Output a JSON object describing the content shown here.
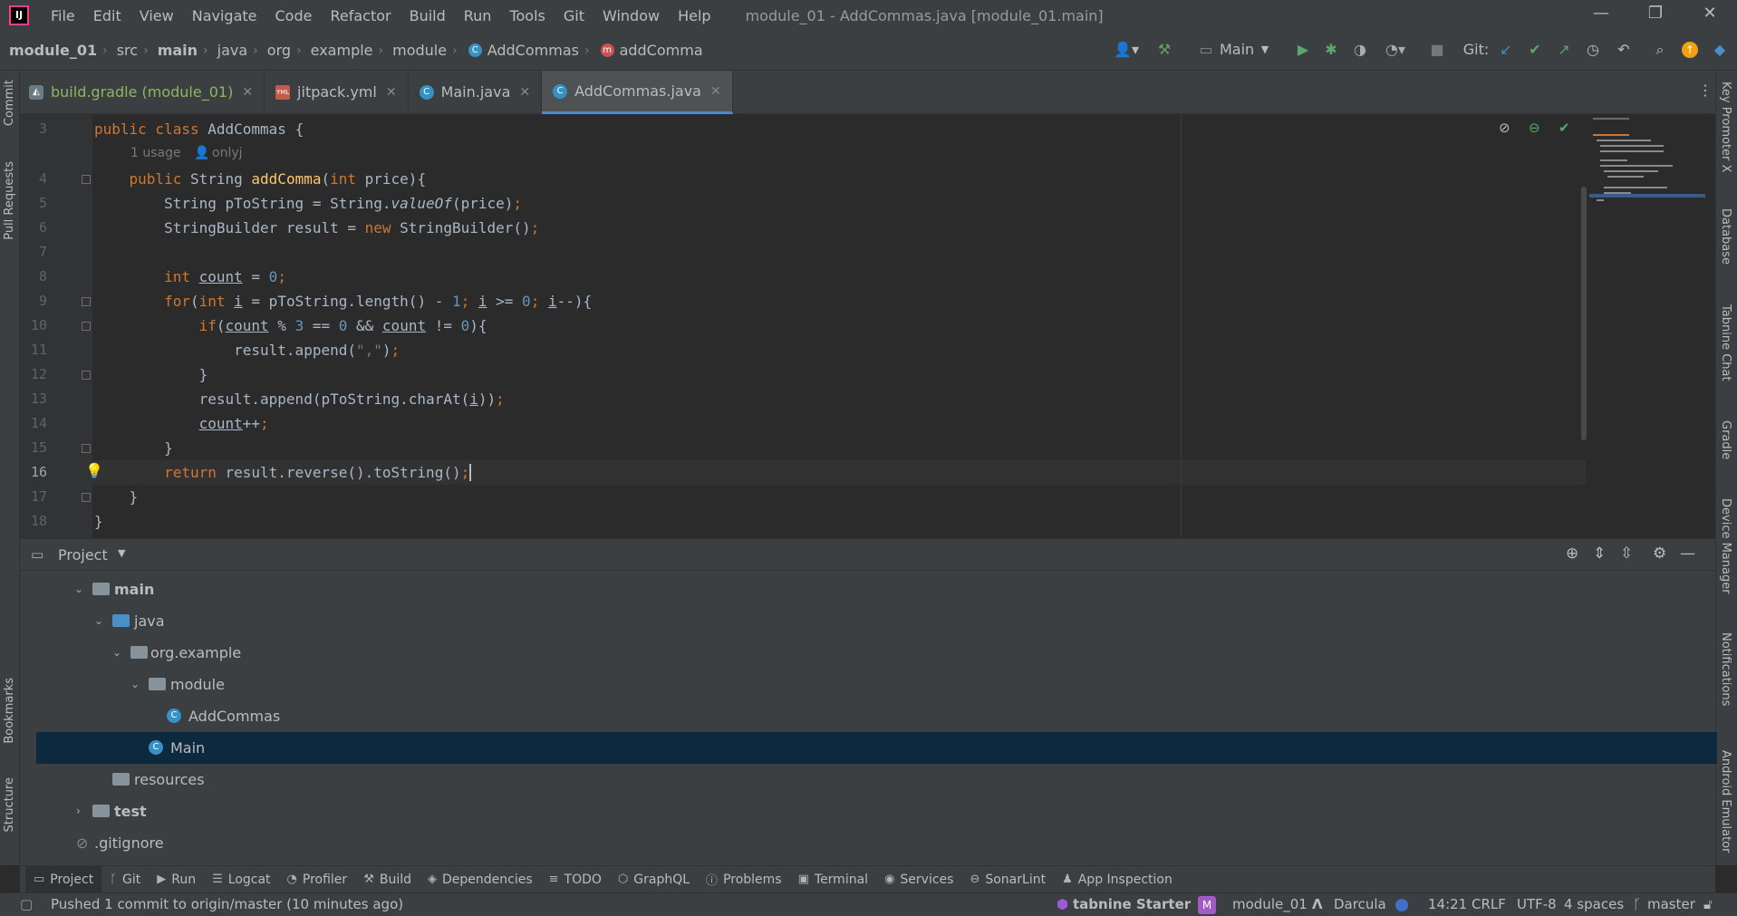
{
  "menubar": {
    "items": [
      "File",
      "Edit",
      "View",
      "Navigate",
      "Code",
      "Refactor",
      "Build",
      "Run",
      "Tools",
      "Git",
      "Window",
      "Help"
    ],
    "title": "module_01 - AddCommas.java [module_01.main]"
  },
  "breadcrumb": [
    "module_01",
    "src",
    "main",
    "java",
    "org",
    "example",
    "module",
    "AddCommas",
    "addComma"
  ],
  "toolbar": {
    "run_config": "Main",
    "git_label": "Git:"
  },
  "tabs": [
    {
      "label": "build.gradle (module_01)",
      "icon": "gradle-icon"
    },
    {
      "label": "jitpack.yml",
      "icon": "yaml-icon"
    },
    {
      "label": "Main.java",
      "icon": "java-class-icon"
    },
    {
      "label": "AddCommas.java",
      "icon": "java-class-icon",
      "active": true
    }
  ],
  "editor": {
    "caret_line": 16,
    "usage_hint": {
      "usages": "1 usage",
      "author": "onlyj"
    },
    "lines": [
      {
        "n": "3",
        "text": "public class AddCommas {"
      },
      {
        "n": "4",
        "text": "    public String addComma(int price){"
      },
      {
        "n": "5",
        "text": "        String pToString = String.valueOf(price);"
      },
      {
        "n": "6",
        "text": "        StringBuilder result = new StringBuilder();"
      },
      {
        "n": "7",
        "text": ""
      },
      {
        "n": "8",
        "text": "        int count = 0;"
      },
      {
        "n": "9",
        "text": "        for(int i = pToString.length() - 1; i >= 0; i--){"
      },
      {
        "n": "10",
        "text": "            if(count % 3 == 0 && count != 0){"
      },
      {
        "n": "11",
        "text": "                result.append(\",\");"
      },
      {
        "n": "12",
        "text": "            }"
      },
      {
        "n": "13",
        "text": "            result.append(pToString.charAt(i));"
      },
      {
        "n": "14",
        "text": "            count++;"
      },
      {
        "n": "15",
        "text": "        }"
      },
      {
        "n": "16",
        "text": "        return result.reverse().toString();"
      },
      {
        "n": "17",
        "text": "    }"
      },
      {
        "n": "18",
        "text": "}"
      }
    ]
  },
  "left_stripe": [
    "Commit",
    "Pull Requests",
    "Bookmarks",
    "Structure"
  ],
  "right_stripe": [
    "Key Promoter X",
    "Database",
    "Tabnine Chat",
    "Gradle",
    "Device Manager",
    "Notifications",
    "Android Emulator"
  ],
  "project": {
    "title": "Project",
    "tree": [
      {
        "label": "main",
        "bold": true,
        "icon": "folder-icon"
      },
      {
        "label": "java",
        "icon": "source-folder-icon"
      },
      {
        "label": "org.example",
        "icon": "package-icon"
      },
      {
        "label": "module",
        "icon": "package-icon"
      },
      {
        "label": "AddCommas",
        "icon": "java-class-icon"
      },
      {
        "label": "Main",
        "icon": "java-main-class-icon",
        "selected": true
      },
      {
        "label": "resources",
        "icon": "resources-folder-icon"
      },
      {
        "label": "test",
        "bold": true,
        "icon": "folder-icon"
      },
      {
        "label": ".gitignore",
        "icon": "gitignore-icon"
      }
    ]
  },
  "tool_windows": [
    "Project",
    "Git",
    "Run",
    "Logcat",
    "Profiler",
    "Build",
    "Dependencies",
    "TODO",
    "GraphQL",
    "Problems",
    "Terminal",
    "Services",
    "SonarLint",
    "App Inspection"
  ],
  "status": {
    "message": "Pushed 1 commit to origin/master (10 minutes ago)",
    "tabnine": "tabnine Starter",
    "module_badge": "M",
    "module": "module_01",
    "theme": "Darcula",
    "position": "14:21",
    "line_sep": "CRLF",
    "encoding": "UTF-8",
    "indent": "4 spaces",
    "branch": "master"
  },
  "colors": {
    "accent": "#4a88c7",
    "keyword": "#cc7832",
    "function": "#ffc66d",
    "number": "#6897bb",
    "string": "#6a8759",
    "selection": "#0d293e"
  }
}
